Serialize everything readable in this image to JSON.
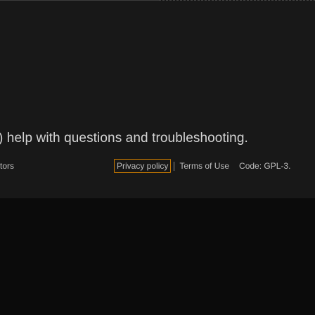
{
  "footer": {
    "help_text": ") help with questions and troubleshooting.",
    "contributors_label": "tors",
    "legal": {
      "privacy_label": "Privacy policy",
      "terms_label": "Terms of Use",
      "code_label": "Code: GPL-3."
    }
  },
  "colors": {
    "footer_background": "#181818",
    "page_background": "#0b0b0b",
    "text": "#d4d4d4",
    "focus_ring": "#c97a00"
  }
}
